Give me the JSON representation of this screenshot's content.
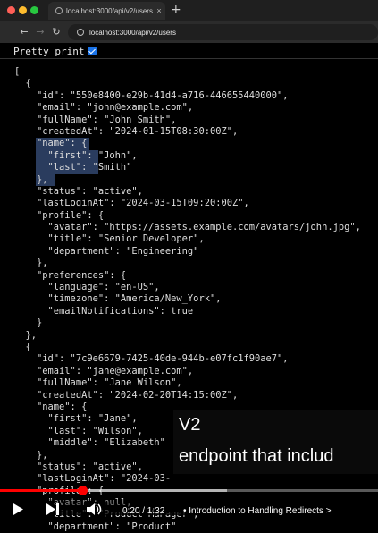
{
  "browser": {
    "tab_title": "localhost:3000/api/v2/users",
    "tab_close": "×",
    "new_tab": "+",
    "back": "←",
    "forward": "→",
    "reload": "↻",
    "url": "localhost:3000/api/v2/users",
    "traffic_colors": [
      "#ff5f57",
      "#febc2e",
      "#28c840"
    ]
  },
  "page": {
    "pretty_print_label": "Pretty print",
    "pretty_print_checked": true
  },
  "json_lines": [
    "[",
    "  {",
    "    \"id\": \"550e8400-e29b-41d4-a716-446655440000\",",
    "    \"email\": \"john@example.com\",",
    "    \"fullName\": \"John Smith\",",
    "    \"createdAt\": \"2024-01-15T08:30:00Z\",",
    "    \"name\": {",
    "      \"first\": \"John\",",
    "      \"last\": \"Smith\"",
    "    },",
    "    \"status\": \"active\",",
    "    \"lastLoginAt\": \"2024-03-15T09:20:00Z\",",
    "    \"profile\": {",
    "      \"avatar\": \"https://assets.example.com/avatars/john.jpg\",",
    "      \"title\": \"Senior Developer\",",
    "      \"department\": \"Engineering\"",
    "    },",
    "    \"preferences\": {",
    "      \"language\": \"en-US\",",
    "      \"timezone\": \"America/New_York\",",
    "      \"emailNotifications\": true",
    "    }",
    "  },",
    "  {",
    "    \"id\": \"7c9e6679-7425-40de-944b-e07fc1f90ae7\",",
    "    \"email\": \"jane@example.com\",",
    "    \"fullName\": \"Jane Wilson\",",
    "    \"createdAt\": \"2024-02-20T14:15:00Z\",",
    "    \"name\": {",
    "      \"first\": \"Jane\",",
    "      \"last\": \"Wilson\",",
    "      \"middle\": \"Elizabeth\"",
    "    },",
    "    \"status\": \"active\",",
    "    \"lastLoginAt\": \"2024-03-",
    "    \"profile\": {",
    "      \"avatar\": null,",
    "      \"title\": \"Product Manager\",",
    "      \"department\": \"Product\""
  ],
  "highlighted_lines": [
    6,
    7,
    8,
    9
  ],
  "video": {
    "caption_line1": "V2",
    "caption_line2": "endpoint that includ",
    "time": "0:20 / 1:32",
    "chapter": "• Introduction to Handling Redirects >",
    "progress": 0.217,
    "buffered": 0.6
  }
}
